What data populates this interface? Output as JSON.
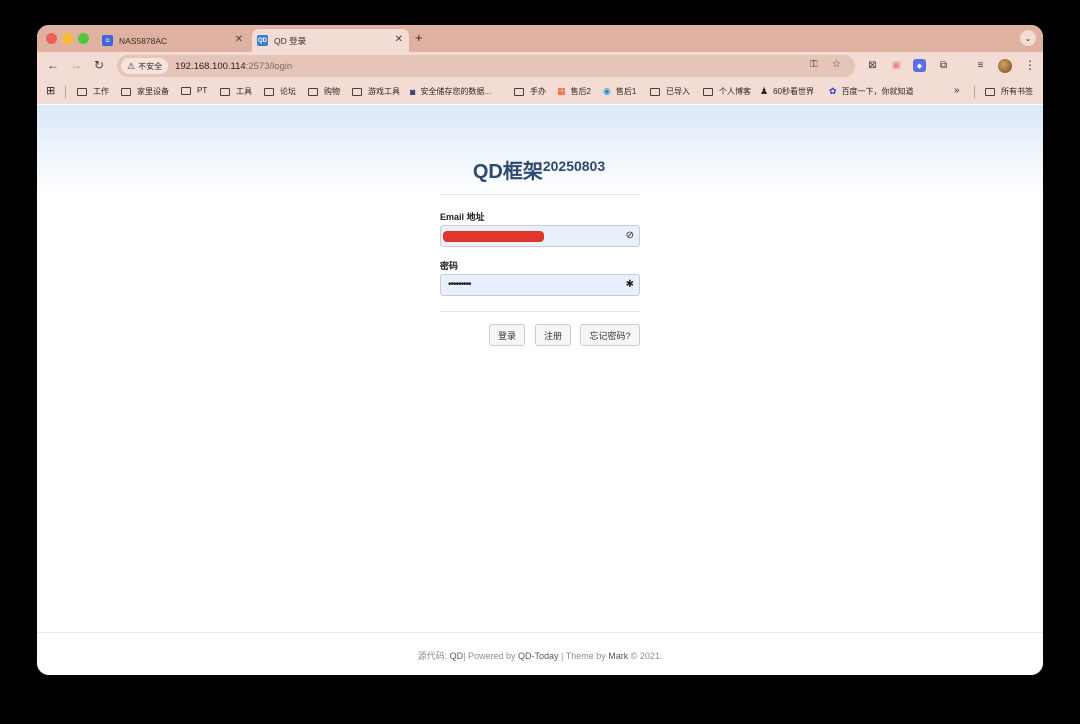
{
  "browser": {
    "tabs": [
      {
        "title": "NAS5878AC",
        "favicon": "nas-icon"
      },
      {
        "title": "QD 登录",
        "favicon": "qd-icon",
        "favicon_text": "QD"
      }
    ],
    "address_bar": {
      "security_label": "不安全",
      "url_host": "192.168.100.114",
      "url_path": ":2573/login"
    },
    "bookmarks": [
      {
        "label": "工作",
        "icon": "folder-icon"
      },
      {
        "label": "家里设备",
        "icon": "folder-icon"
      },
      {
        "label": "PT",
        "icon": "folder-icon"
      },
      {
        "label": "工具",
        "icon": "folder-icon"
      },
      {
        "label": "论坛",
        "icon": "folder-icon"
      },
      {
        "label": "购物",
        "icon": "folder-icon"
      },
      {
        "label": "游戏工具",
        "icon": "folder-icon"
      },
      {
        "label": "安全储存您的数据...",
        "icon": "vault-icon"
      },
      {
        "label": "手办",
        "icon": "folder-icon"
      },
      {
        "label": "售后2",
        "icon": "microsoft-icon"
      },
      {
        "label": "售后1",
        "icon": "edge-icon"
      },
      {
        "label": "已导入",
        "icon": "folder-icon"
      },
      {
        "label": "个人博客",
        "icon": "folder-icon"
      },
      {
        "label": "60秒看世界",
        "icon": "penguin-icon"
      },
      {
        "label": "百度一下，你就知道",
        "icon": "baidu-icon"
      },
      {
        "label": "所有书签",
        "icon": "folder-icon"
      }
    ],
    "more_bookmarks": "»"
  },
  "page": {
    "title": "QD框架",
    "version": "20250803",
    "email_label": "Email 地址",
    "password_label": "密码",
    "password_value": "•••••••••",
    "buttons": {
      "login": "登录",
      "register": "注册",
      "forgot": "忘记密码?"
    },
    "footer": {
      "source_label": "源代码: ",
      "source_link": "QD",
      "powered_by": "| Powered by ",
      "powered_link": "QD-Today",
      "theme_by": " | Theme by ",
      "theme_link": "Mark",
      "copyright": " © 2021."
    }
  }
}
